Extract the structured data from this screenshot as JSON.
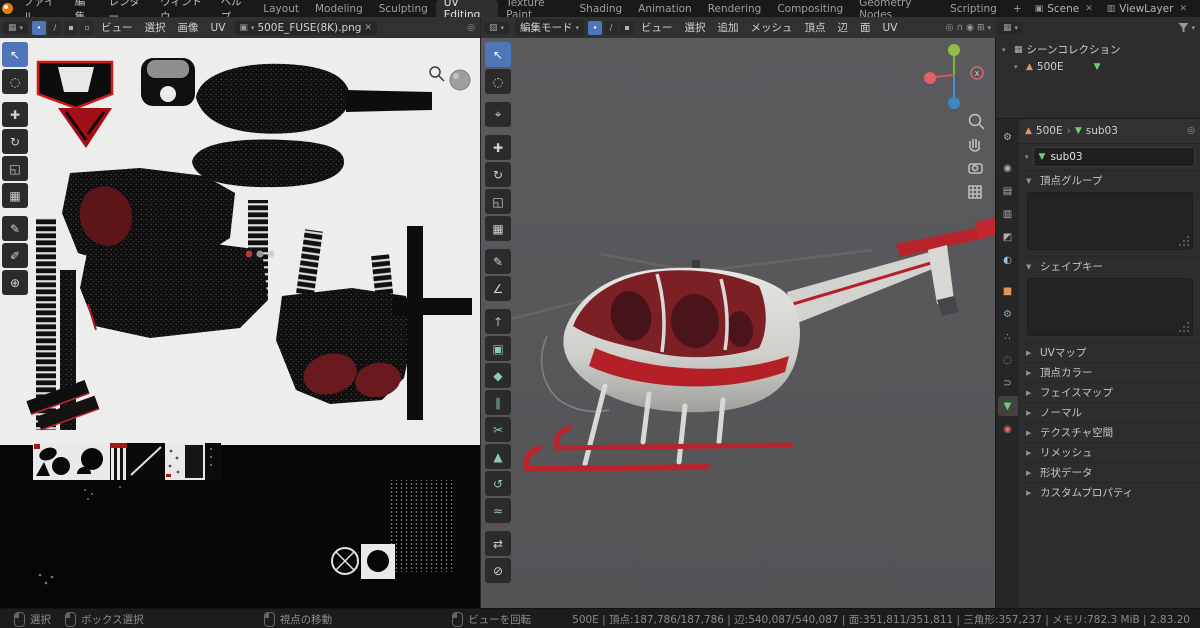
{
  "topbar": {
    "menus": [
      "ファイル",
      "編集",
      "レンダー",
      "ウィンドウ",
      "ヘルプ"
    ],
    "tabs": [
      "Layout",
      "Modeling",
      "Sculpting",
      "UV Editing",
      "Texture Paint",
      "Shading",
      "Animation",
      "Rendering",
      "Compositing",
      "Geometry Nodes",
      "Scripting"
    ],
    "add_tab": "+",
    "scene_icon": "▣",
    "scene_label": "Scene",
    "viewlayer_icon": "▥",
    "viewlayer_label": "ViewLayer",
    "close": "✕",
    "dropdown": "▾"
  },
  "uv_editor": {
    "editor_icon": "▦",
    "dropdown": "▾",
    "select_modes": [
      "∙",
      "∕",
      "▪",
      "▫"
    ],
    "menus": [
      "ビュー",
      "選択",
      "画像",
      "UV"
    ],
    "datablock_icon": "▣",
    "image_name": "500E_FUSE(8K).png",
    "unlink": "✕",
    "pin": "◎",
    "tools": [
      "↖",
      "◌",
      "✚",
      "↻",
      "◱",
      "▦",
      "✎",
      "✐",
      "⊕"
    ]
  },
  "viewport": {
    "editor_icon": "▧",
    "dropdown": "▾",
    "mode": "編集モード",
    "select_modes": [
      "∙",
      "∕",
      "▪"
    ],
    "menus": [
      "ビュー",
      "選択",
      "追加",
      "メッシュ",
      "頂点",
      "辺",
      "面",
      "UV"
    ],
    "header_icons": [
      "◎",
      "∩",
      "◉",
      "⊞"
    ],
    "tools": [
      "↖",
      "◌",
      "⌖",
      "✚",
      "↻",
      "◱",
      "▦",
      "✎",
      "∠",
      "↑",
      "▣",
      "◆",
      "∥",
      "✂",
      "▲",
      "↺",
      "≈",
      "⇄",
      "⊘"
    ],
    "axis_x": "X"
  },
  "outliner": {
    "rows": [
      {
        "arrow": "▾",
        "icon": "▦",
        "label": "シーンコレクション"
      },
      {
        "arrow": "▾",
        "icon": "▲",
        "label": "500E",
        "data_icon": "▼"
      }
    ]
  },
  "properties": {
    "tabs": [
      {
        "glyph": "⚙"
      },
      {
        "glyph": "◉"
      },
      {
        "glyph": "▤"
      },
      {
        "glyph": "▥"
      },
      {
        "glyph": "◩"
      },
      {
        "glyph": "◐"
      },
      {
        "glyph": "■"
      },
      {
        "glyph": "⚙"
      },
      {
        "glyph": "∴"
      },
      {
        "glyph": "◌"
      },
      {
        "glyph": "⊃"
      },
      {
        "glyph": "▼"
      },
      {
        "glyph": "◉"
      }
    ],
    "breadcrumb": {
      "object_icon": "▲",
      "object": "500E",
      "sep": "›",
      "data_icon": "▼",
      "data": "sub03"
    },
    "name": {
      "arrow": "▾",
      "icon": "▼",
      "value": "sub03"
    },
    "sections": [
      {
        "arrow": "▼",
        "label": "頂点グループ"
      },
      {
        "arrow": "▼",
        "label": "シェイプキー"
      },
      {
        "arrow": "▶",
        "label": "UVマップ"
      },
      {
        "arrow": "▶",
        "label": "頂点カラー"
      },
      {
        "arrow": "▶",
        "label": "フェイスマップ"
      },
      {
        "arrow": "▶",
        "label": "ノーマル"
      },
      {
        "arrow": "▶",
        "label": "テクスチャ空間"
      },
      {
        "arrow": "▶",
        "label": "リメッシュ"
      },
      {
        "arrow": "▶",
        "label": "形状データ"
      },
      {
        "arrow": "▶",
        "label": "カスタムプロパティ"
      }
    ]
  },
  "statusbar": {
    "hints": [
      "選択",
      "ボックス選択",
      "視点の移動",
      "ビューを回転"
    ],
    "stats": "500E | 頂点:187,786/187,786 | 辺:540,087/540,087 | 面:351,811/351,811 | 三角形:357,237 | メモリ:782.3 MiB | 2.83.20"
  }
}
